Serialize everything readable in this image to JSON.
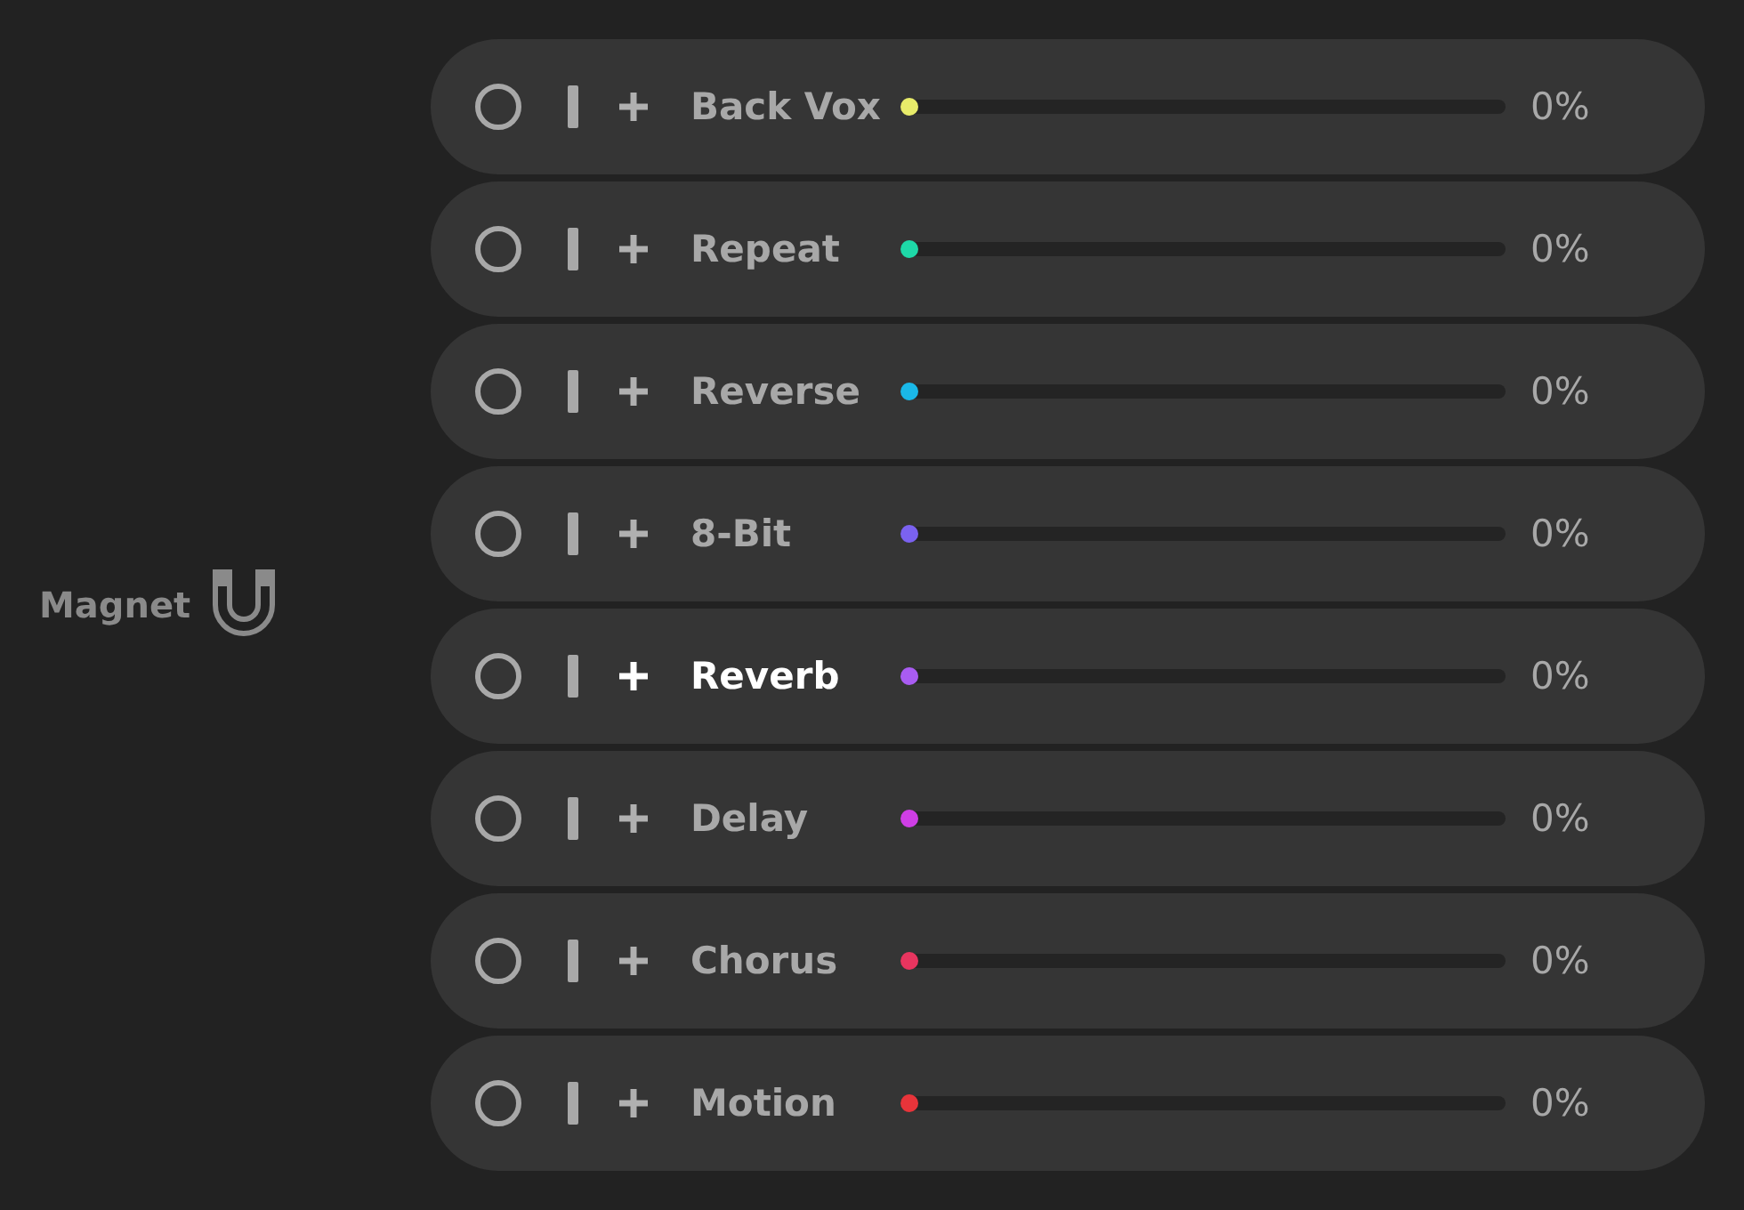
{
  "magnet": {
    "label": "Magnet"
  },
  "effects": [
    {
      "name": "Back Vox",
      "selected": false,
      "color": "#e8ec6a",
      "level": 0,
      "reading": "0%"
    },
    {
      "name": "Repeat",
      "selected": false,
      "color": "#1ed9a8",
      "level": 0,
      "reading": "0%"
    },
    {
      "name": "Reverse",
      "selected": false,
      "color": "#1ab8e8",
      "level": 0,
      "reading": "0%"
    },
    {
      "name": "8-Bit",
      "selected": false,
      "color": "#7b62f0",
      "level": 0,
      "reading": "0%"
    },
    {
      "name": "Reverb",
      "selected": true,
      "color": "#a95cf2",
      "level": 0,
      "reading": "0%"
    },
    {
      "name": "Delay",
      "selected": false,
      "color": "#cf3ee6",
      "level": 0,
      "reading": "0%"
    },
    {
      "name": "Chorus",
      "selected": false,
      "color": "#e8355f",
      "level": 0,
      "reading": "0%"
    },
    {
      "name": "Motion",
      "selected": false,
      "color": "#e8343a",
      "level": 0,
      "reading": "0%"
    }
  ]
}
